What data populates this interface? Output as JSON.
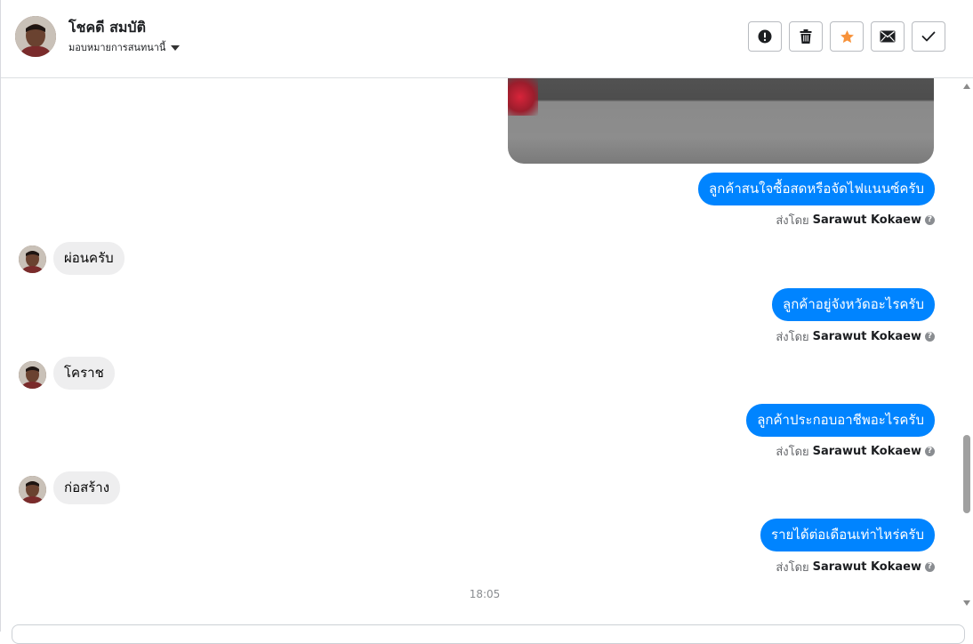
{
  "header": {
    "contact_name": "โชคดี สมบัติ",
    "assign_label": "มอบหมายการสนทนานี้",
    "actions": [
      "spam-icon",
      "trash-icon",
      "star-icon",
      "mail-icon",
      "check-icon"
    ]
  },
  "colors": {
    "outgoing_bubble": "#0084ff",
    "incoming_bubble": "#eeeeef",
    "star": "#f7923a"
  },
  "messages": [
    {
      "direction": "out",
      "text": "ลูกค้าสนใจซื้อสดหรือจัดไฟแนนซ์ครับ",
      "sent_by_label": "ส่งโดย",
      "sender": "Sarawut Kokaew"
    },
    {
      "direction": "in",
      "text": "ผ่อนครับ"
    },
    {
      "direction": "out",
      "text": "ลูกค้าอยู่จังหวัดอะไรครับ",
      "sent_by_label": "ส่งโดย",
      "sender": "Sarawut Kokaew"
    },
    {
      "direction": "in",
      "text": "โคราช"
    },
    {
      "direction": "out",
      "text": "ลูกค้าประกอบอาชีพอะไรครับ",
      "sent_by_label": "ส่งโดย",
      "sender": "Sarawut Kokaew"
    },
    {
      "direction": "in",
      "text": "ก่อสร้าง"
    },
    {
      "direction": "out",
      "text": "รายได้ต่อเดือนเท่าไหร่ครับ",
      "sent_by_label": "ส่งโดย",
      "sender": "Sarawut Kokaew"
    }
  ],
  "time_separator": "18:05"
}
